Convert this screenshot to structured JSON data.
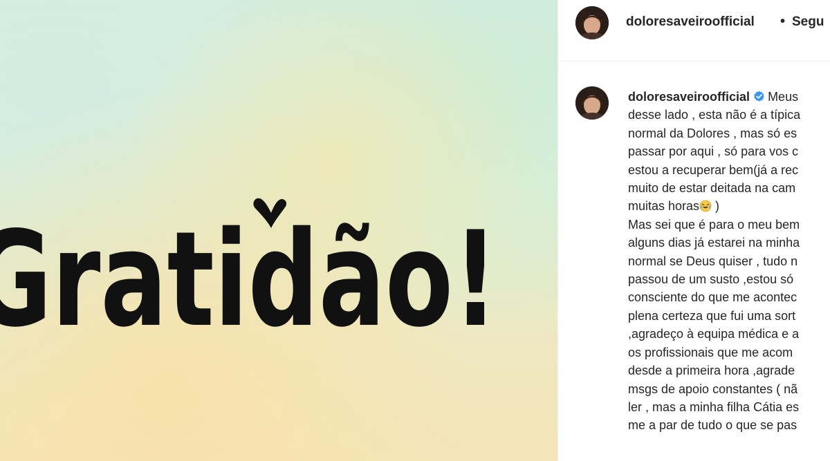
{
  "post": {
    "image": {
      "text": "Gratidão!",
      "icon": "heart-icon"
    },
    "header": {
      "username": "doloresaveiroofficial",
      "separator": "•",
      "follow_label": "Segu"
    },
    "caption": {
      "username": "doloresaveiroofficial",
      "verified_icon": "verified-badge-icon",
      "first_line": "Meus",
      "lines": [
        "desse lado , esta não é a típica",
        "normal da Dolores , mas só es",
        "passar por aqui , só para vos c",
        "estou a recuperar bem(já a rec",
        "muito de estar deitada na cam",
        "muitas horas",
        "Mas sei que é para o meu bem",
        "alguns dias já estarei na minha",
        "normal se Deus quiser , tudo n",
        "passou de um susto ,estou só",
        "consciente do que me acontec",
        "plena certeza que fui uma sort",
        ",agradeço à equipa médica e a",
        "os profissionais que me acom",
        "desde a primeira hora ,agrade",
        "msgs de apoio constantes ( nã",
        "ler , mas a minha filha Cátia es",
        "me a par de tudo o que se pas"
      ],
      "emoji_icon": "laughing-crying-emoji-icon",
      "after_emoji": " )"
    },
    "colors": {
      "text": "#262626",
      "verified": "#3897f0",
      "border": "#efefef"
    }
  }
}
